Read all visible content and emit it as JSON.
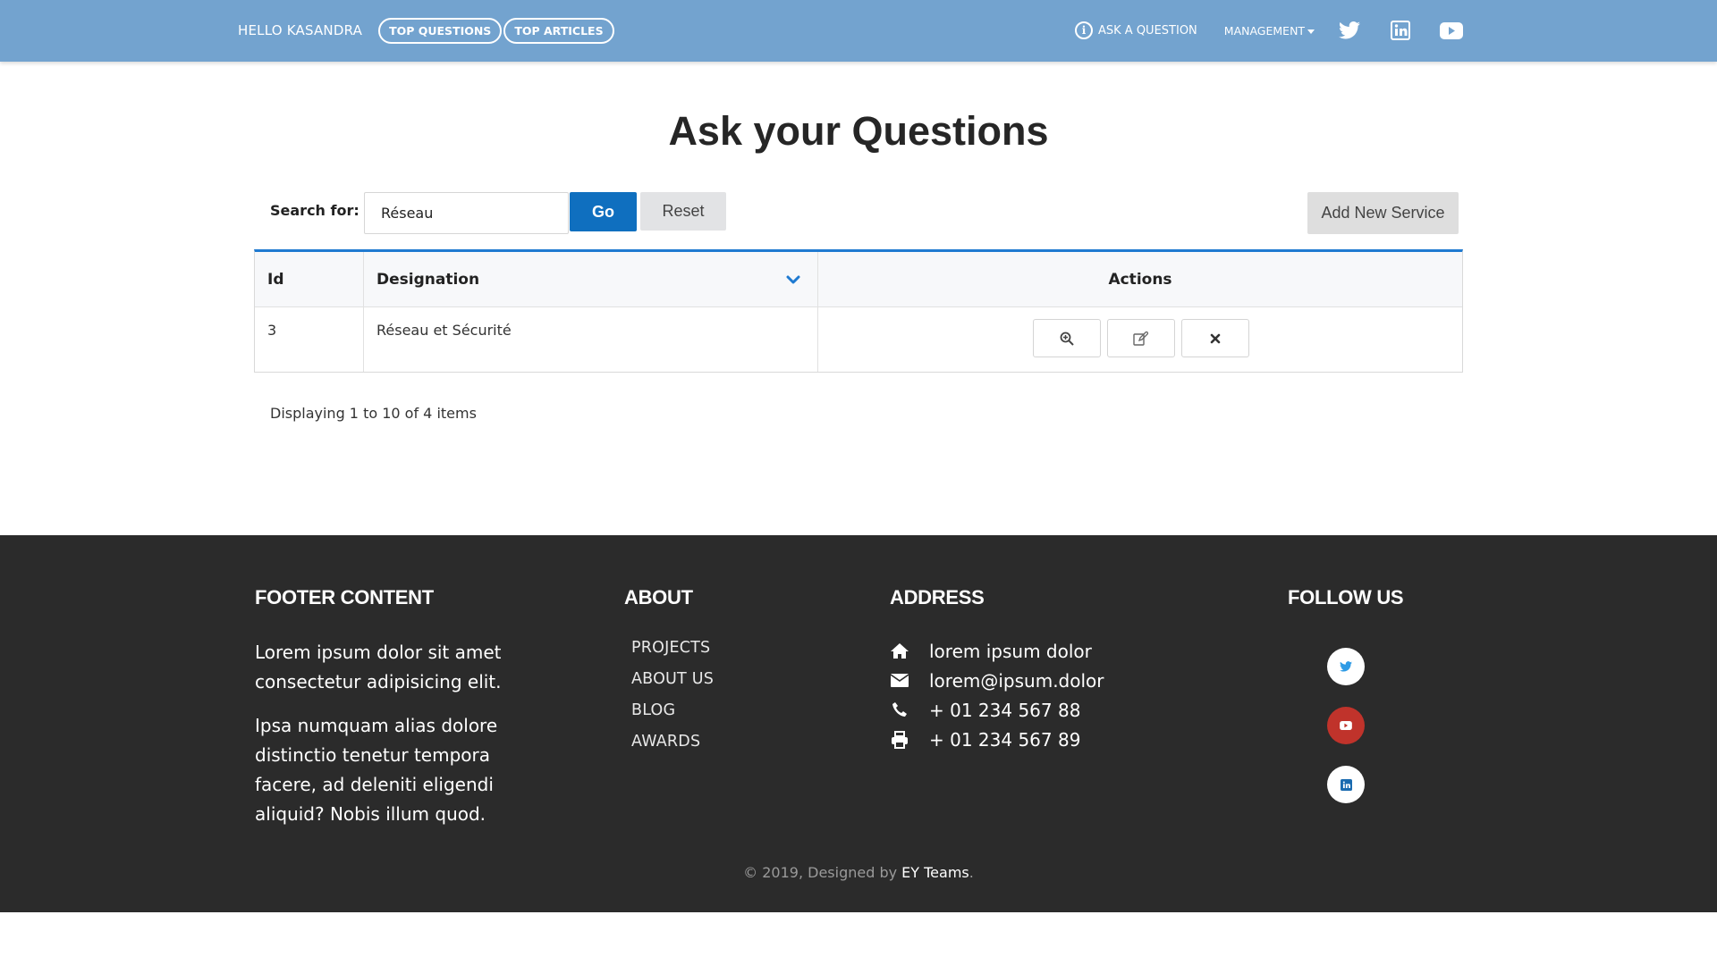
{
  "navbar": {
    "greeting": "HELLO KASANDRA",
    "pills": [
      "TOP QUESTIONS",
      "TOP ARTICLES"
    ],
    "ask_label": "ASK A QUESTION",
    "management_label": "MANAGEMENT",
    "social_icons": [
      "twitter-icon",
      "linkedin-icon",
      "youtube-icon"
    ]
  },
  "main": {
    "title": "Ask your Questions",
    "search_label": "Search for:",
    "search_value": "Réseau",
    "go_label": "Go",
    "reset_label": "Reset",
    "add_label": "Add New Service",
    "table": {
      "headers": [
        "Id",
        "Designation",
        "Actions"
      ],
      "rows": [
        {
          "id": "3",
          "designation": "Réseau et Sécurité"
        }
      ]
    },
    "displaying": "Displaying 1 to 10 of 4 items"
  },
  "footer": {
    "content_heading": "FOOTER CONTENT",
    "paragraph1": "Lorem ipsum dolor sit amet consectetur adipisicing elit.",
    "paragraph2": "Ipsa numquam alias dolore distinctio tenetur tempora facere, ad deleniti eligendi aliquid? Nobis illum quod.",
    "about_heading": "ABOUT",
    "about_links": [
      "PROJECTS",
      "ABOUT US",
      "BLOG",
      "AWARDS"
    ],
    "address_heading": "ADDRESS",
    "address": {
      "home": "lorem ipsum dolor",
      "email": "lorem@ipsum.dolor",
      "phone": "+ 01 234 567 88",
      "fax": "+ 01 234 567 89"
    },
    "follow_heading": "FOLLOW US",
    "copyright_prefix": "© 2019, Designed by ",
    "copyright_link": "EY Teams",
    "copyright_suffix": "."
  },
  "colors": {
    "navbar": "#73a3cf",
    "primary": "#0f6fbf",
    "footer": "#2b2b2b",
    "youtube": "#c0332b"
  }
}
